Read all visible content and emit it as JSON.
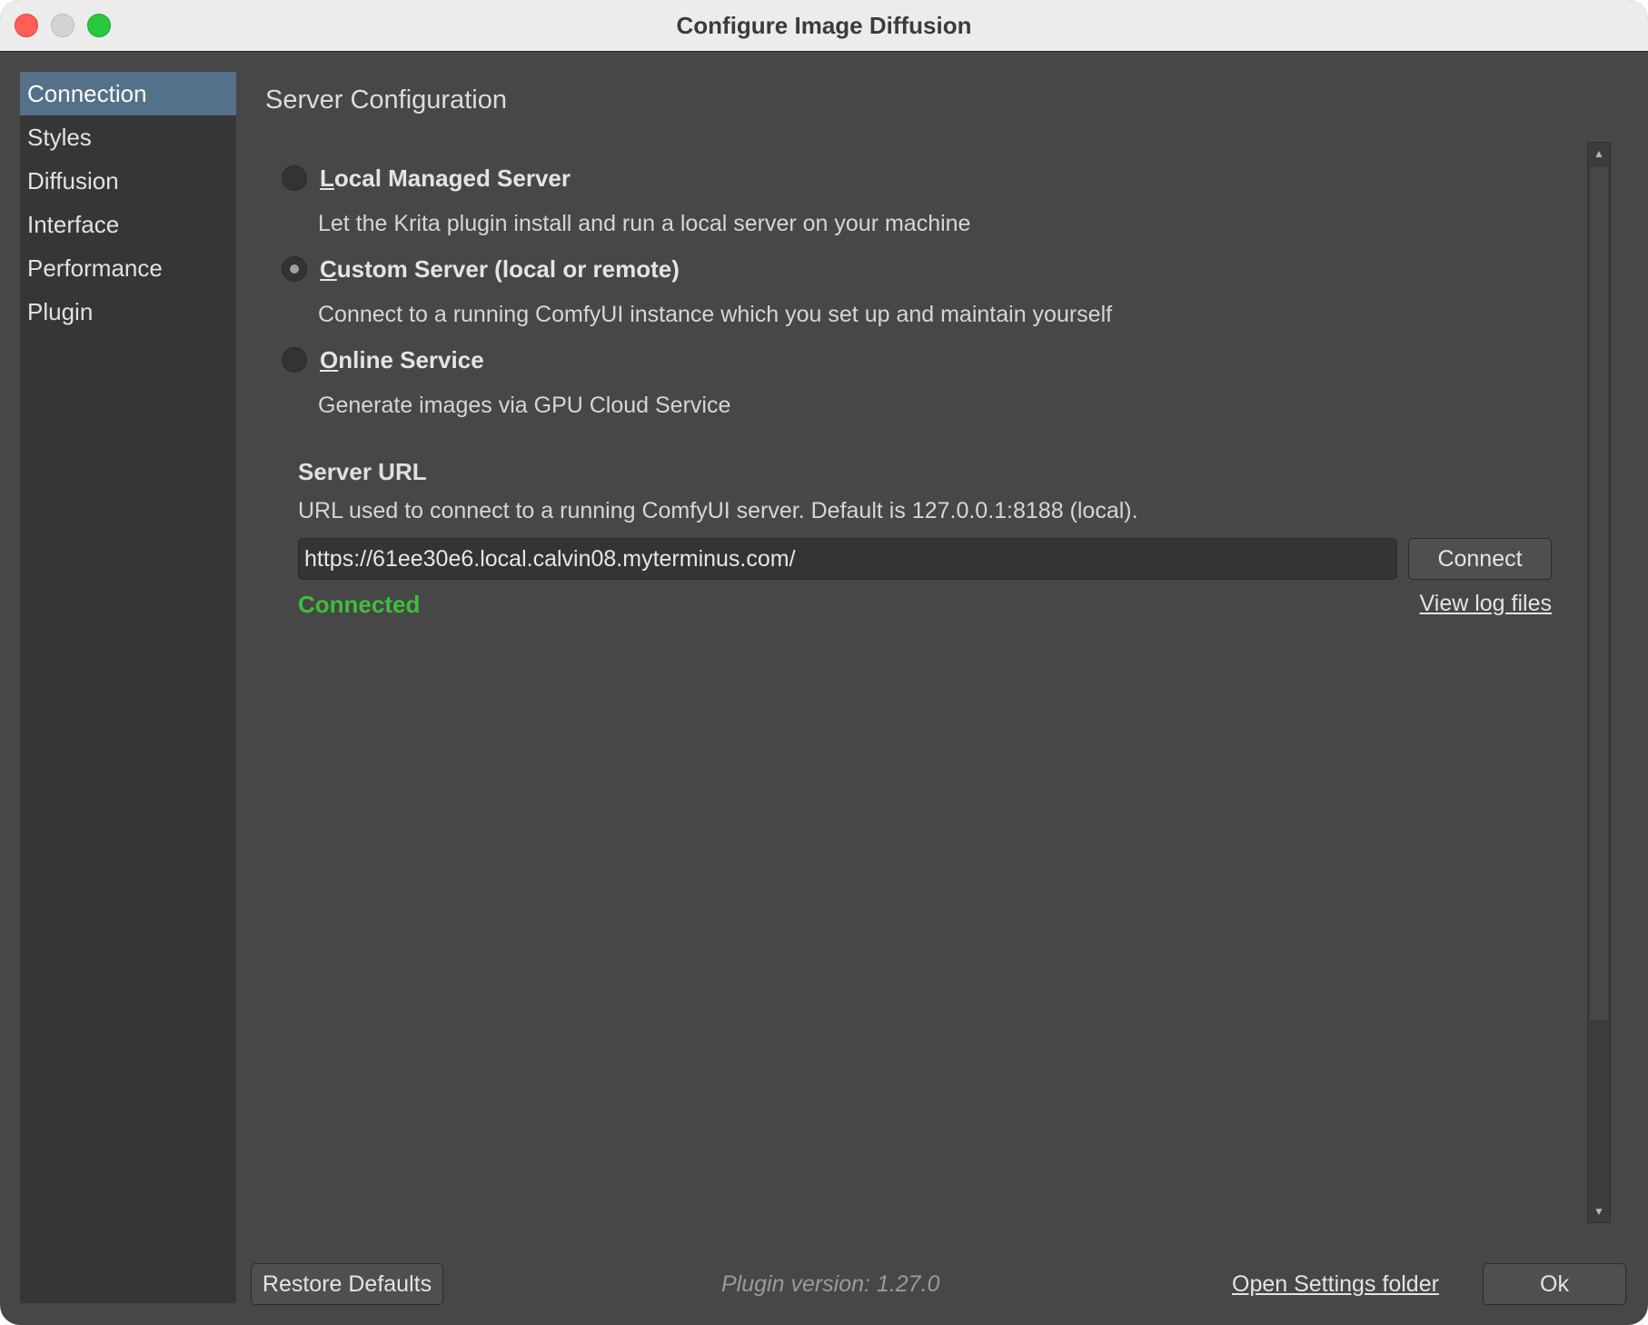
{
  "window": {
    "title": "Configure Image Diffusion"
  },
  "sidebar": {
    "items": [
      {
        "label": "Connection",
        "active": true
      },
      {
        "label": "Styles",
        "active": false
      },
      {
        "label": "Diffusion",
        "active": false
      },
      {
        "label": "Interface",
        "active": false
      },
      {
        "label": "Performance",
        "active": false
      },
      {
        "label": "Plugin",
        "active": false
      }
    ]
  },
  "server_config": {
    "title": "Server Configuration",
    "options": [
      {
        "label_mnemonic": "L",
        "label_rest": "ocal Managed Server",
        "description": "Let the Krita plugin install and run a local server on your machine",
        "selected": false
      },
      {
        "label_mnemonic": "C",
        "label_rest": "ustom Server (local or remote)",
        "description": "Connect to a running ComfyUI instance which you set up and maintain yourself",
        "selected": true
      },
      {
        "label_mnemonic": "O",
        "label_rest": "nline Service",
        "description": "Generate images via GPU Cloud Service",
        "selected": false
      }
    ],
    "server_url": {
      "heading": "Server URL",
      "help": "URL used to connect to a running ComfyUI server. Default is 127.0.0.1:8188 (local).",
      "value": "https://61ee30e6.local.calvin08.myterminus.com/",
      "connect_label": "Connect",
      "status": "Connected",
      "status_color": "#3cbf3c",
      "view_log_label": "View log files"
    }
  },
  "footer": {
    "restore_label": "Restore Defaults",
    "version": "Plugin version: 1.27.0",
    "open_settings_label": "Open Settings folder",
    "ok_label": "Ok"
  },
  "icons": {
    "scroll_up": "triangle-up",
    "scroll_down": "triangle-down"
  },
  "colors": {
    "window_bg": "#474747",
    "sidebar_bg": "#363636",
    "selection": "#557189",
    "traffic_close": "#fe5f57",
    "traffic_min": "#d3d3d3",
    "traffic_max": "#28c840"
  }
}
